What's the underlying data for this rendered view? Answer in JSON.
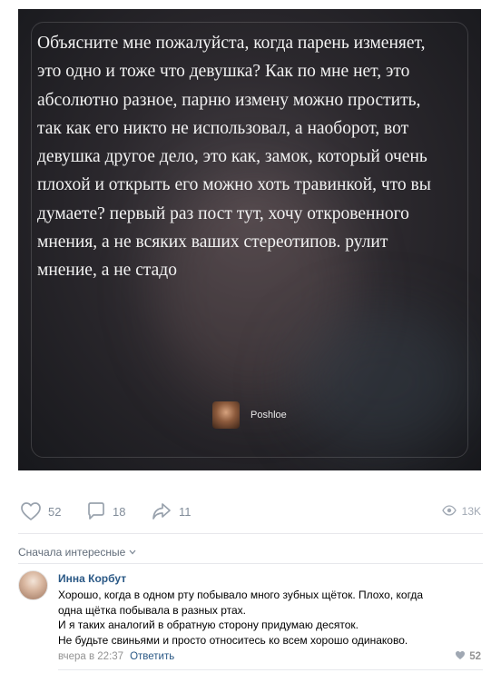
{
  "post": {
    "text": "Объясните мне пожалуйста, когда парень изменяет, это одно и тоже что девушка? Как по мне нет, это абсолютно разное, парню измену можно простить, так как его никто не использовал, а наоборот, вот девушка другое дело, это как, замок, который очень плохой и открыть его можно хоть травинкой, что вы думаете? первый раз пост тут, хочу откровенного мнения, а не всяких ваших стереотипов. рулит мнение, а не стадо",
    "text_lines": [
      "Объясните мне пожалуйста, когда парень изменяет,",
      "это одно и тоже что девушка? Как по мне нет, это",
      "абсолютно разное, парню измену можно простить,",
      "так как его никто не использовал, а наоборот, вот",
      "девушка другое дело, это как, замок, который очень",
      "плохой и открыть его можно хоть травинкой, что вы",
      "думаете? первый раз пост тут, хочу откровенного",
      "мнения, а не всяких ваших стереотипов. рулит",
      "мнение, а не стадо"
    ],
    "author": "Poshloe",
    "background_colors": [
      "#17181c",
      "#4a4348"
    ]
  },
  "actions": {
    "likes": "52",
    "comments": "18",
    "shares": "11",
    "views": "13K",
    "icons": [
      "heart-icon",
      "comment-icon",
      "share-icon",
      "eye-icon"
    ]
  },
  "comments_section": {
    "sort_label": "Сначала интересные",
    "sort_icon": "chevron-down-icon",
    "items": [
      {
        "author": "Инна Корбут",
        "lines": [
          "Хорошо, когда в одном рту побывало много зубных щёток. Плохо, когда",
          "одна щётка побывала в разных ртах.",
          "И я таких аналогий в обратную сторону придумаю десяток.",
          "Не будьте свиньями и просто относитесь ко всем хорошо одинаково."
        ],
        "time": "вчера в 22:37",
        "reply_label": "Ответить",
        "likes": "52"
      }
    ]
  },
  "colors": {
    "link": "#2a5885",
    "icon_gray": "#818c99",
    "meta_gray": "#939393"
  }
}
